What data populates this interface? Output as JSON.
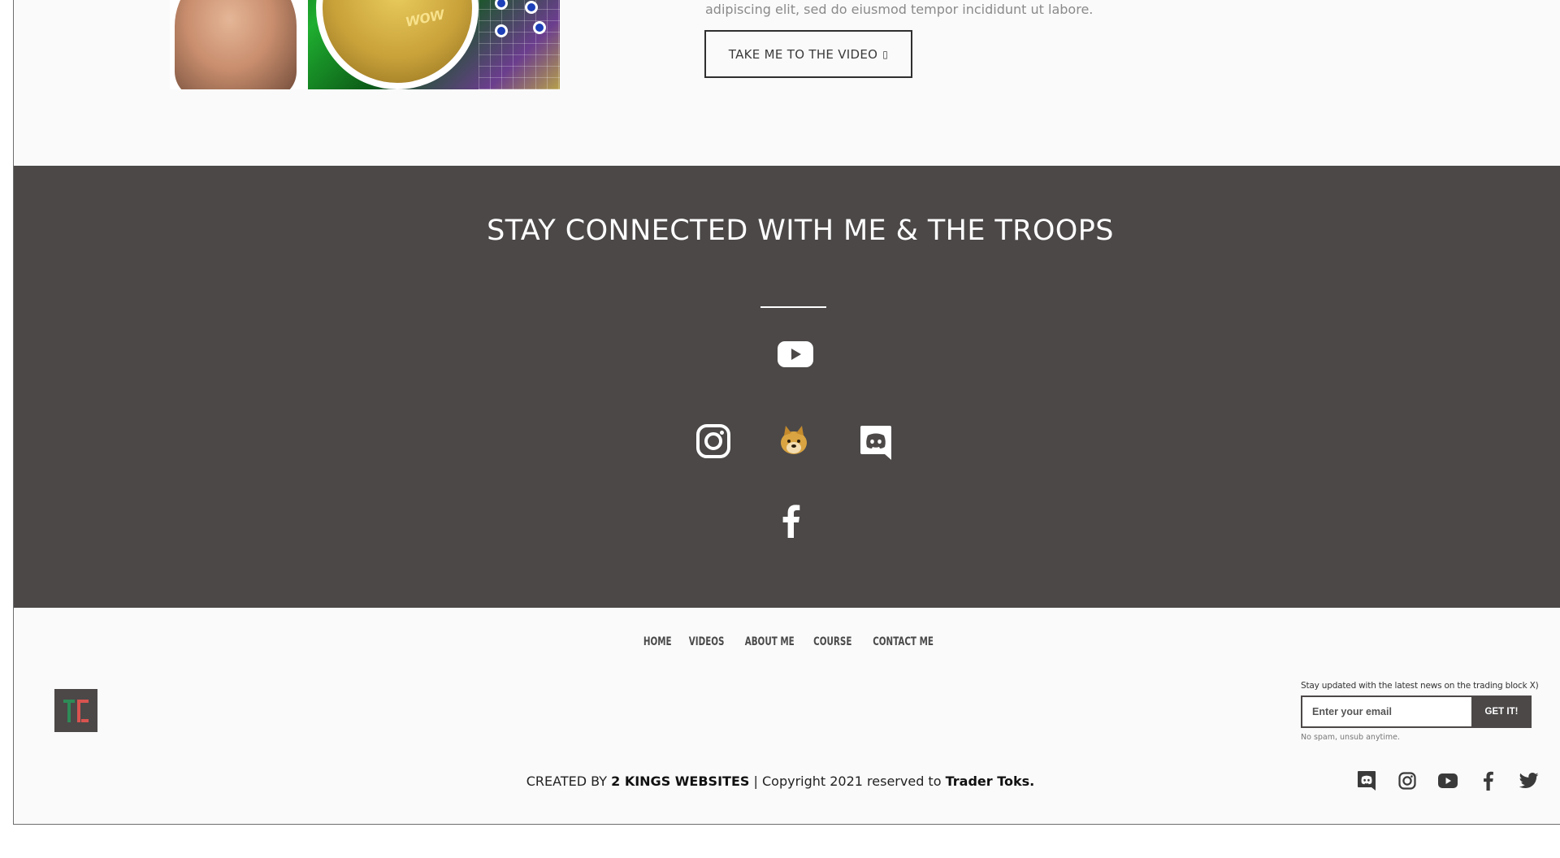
{
  "promo": {
    "text": "adipiscing elit, sed do eiusmod tempor incididunt ut labore.",
    "button_label": "TAKE ME TO THE VIDEO",
    "button_arrow": "▯",
    "thumbnail_coin_text": "wow"
  },
  "band": {
    "title": "STAY CONNECTED WITH ME & THE TROOPS",
    "background": "#4c4848",
    "social_icons": [
      "youtube-icon",
      "instagram-icon",
      "doge-icon",
      "discord-icon",
      "facebook-icon"
    ]
  },
  "nav": {
    "items": [
      {
        "label": "HOME"
      },
      {
        "label": "VIDEOS"
      },
      {
        "label": "ABOUT ME"
      },
      {
        "label": "COURSE"
      },
      {
        "label": "CONTACT ME"
      }
    ]
  },
  "logo": {
    "letters": "TT",
    "colors": {
      "left": "#2e8b57",
      "right": "#d9534f"
    }
  },
  "newsletter": {
    "label": "Stay updated with the latest news on the trading block X)",
    "placeholder": "Enter your email",
    "button_label": "GET IT!",
    "note": "No spam, unsub anytime."
  },
  "credits": {
    "prefix": "CREATED BY",
    "company": "2 KINGS WEBSITES",
    "middle": "| Copyright 2021 reserved to",
    "owner": "Trader Toks."
  },
  "footer_social": [
    "discord-icon",
    "instagram-icon",
    "youtube-icon",
    "facebook-icon",
    "twitter-icon"
  ]
}
